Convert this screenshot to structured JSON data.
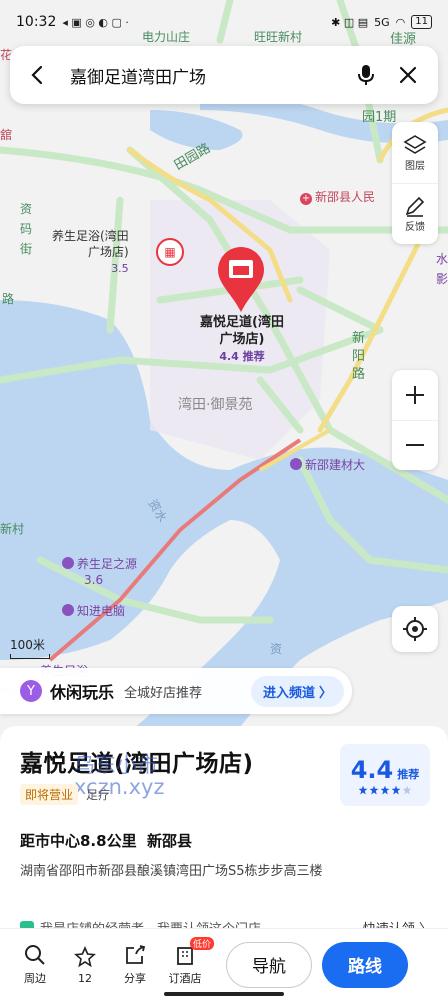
{
  "status": {
    "time": "10:32",
    "signal": "5G",
    "battery": "11"
  },
  "search": {
    "query": "嘉御足道湾田广场"
  },
  "tools": {
    "layers": "图层",
    "feedback": "反馈"
  },
  "scale": "100米",
  "map_labels": {
    "top1": "电力山庄",
    "top2": "旺旺新村",
    "top3": "佳源",
    "top4": "园1期",
    "road1": "田园路",
    "road2": "新阳路",
    "poi_hosp": "新邵县人民",
    "poi_spa1_name": "养生足浴(湾田",
    "poi_spa1_name2": "广场店)",
    "poi_spa1_rating": "3.5",
    "poi_main_name": "嘉悦足道(湾田",
    "poi_main_name2": "广场店)",
    "poi_main_rating": "4.4 推荐",
    "area": "湾田·御景苑",
    "poi_build": "新邵建材大",
    "river": "资水",
    "poi_spa2_name": "养生足之源",
    "poi_spa2_rating": "3.6",
    "poi_pc": "知进电脑",
    "left1": "资",
    "left2": "码",
    "left3": "街",
    "left4": "路",
    "left5": "新村",
    "left6": "舘",
    "left7": "花",
    "right1": "水",
    "right2": "影",
    "poi_bottom": "养生足浴",
    "river2": "资"
  },
  "promo": {
    "title": "休闲玩乐",
    "subtitle": "全城好店推荐",
    "button": "进入频道"
  },
  "place": {
    "name": "嘉悦足道(湾田广场店)",
    "status_tag": "即将营业",
    "category": "足疗",
    "rating": "4.4",
    "rating_label": "推荐",
    "stars": 4,
    "distance": "距市中心8.8公里",
    "district": "新邵县",
    "address": "湖南省邵阳市新邵县酿溪镇湾田广场S5栋步步高三楼",
    "owner_text": "我是店铺的经营者，我要认领这个门店",
    "claim": "快速认领 〉"
  },
  "watermark": {
    "line1": "鸟东小市",
    "line2": "xczn.xyz"
  },
  "bottom_nav": [
    {
      "label": "周边",
      "icon": "search-icon"
    },
    {
      "label": "12",
      "icon": "star-icon"
    },
    {
      "label": "分享",
      "icon": "share-icon"
    },
    {
      "label": "订酒店",
      "icon": "hotel-icon",
      "badge": "低价"
    }
  ],
  "actions": {
    "navigate": "导航",
    "route": "路线"
  },
  "colors": {
    "accent": "#1a6cf0",
    "pin": "#e8343f",
    "road": "#c9e9c6",
    "water": "#bcd6f2"
  }
}
